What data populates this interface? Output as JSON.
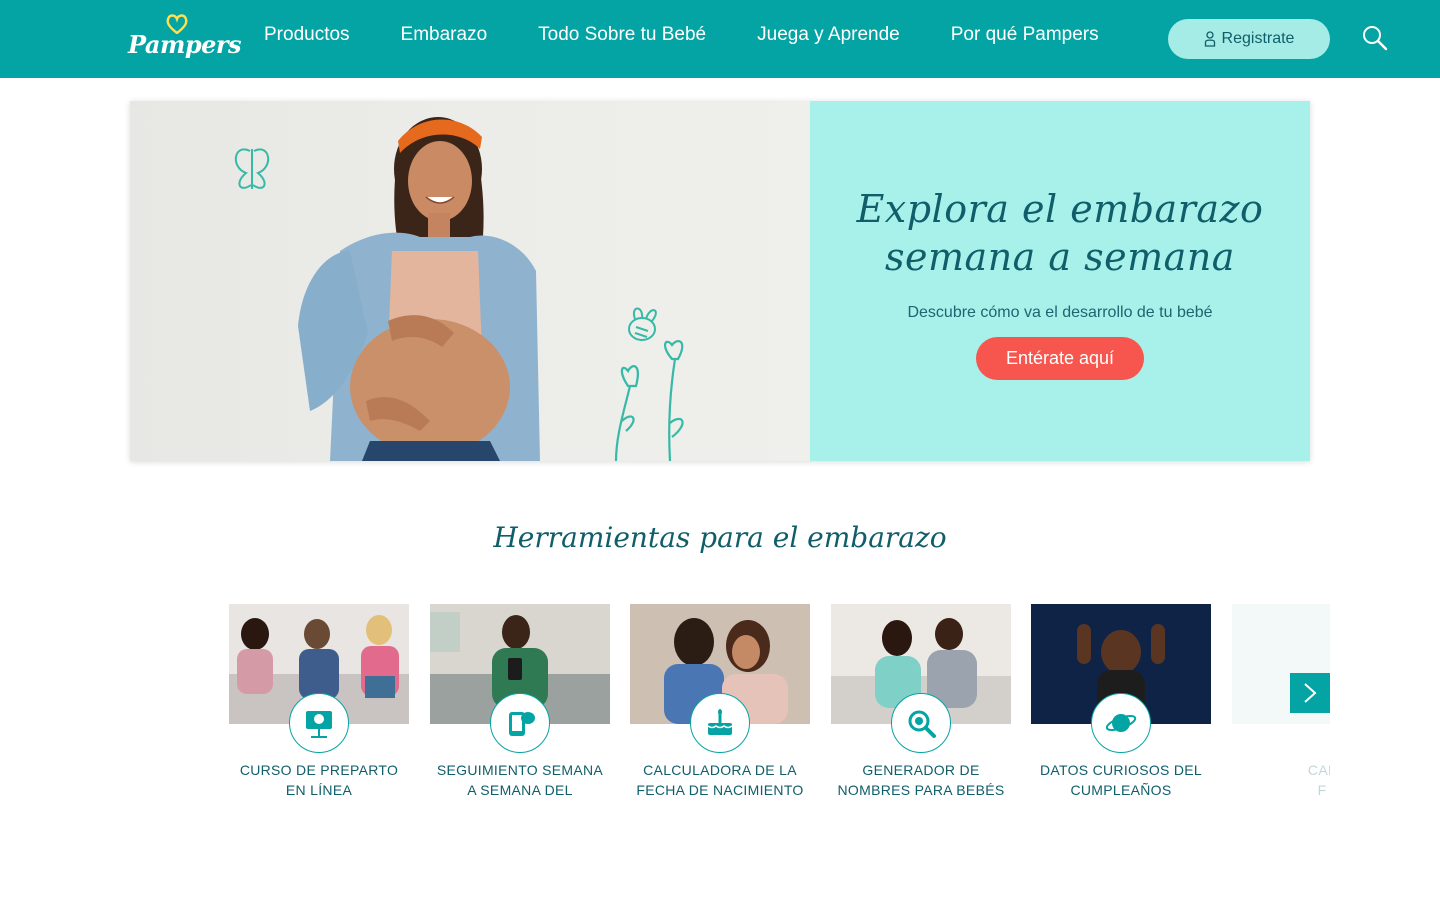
{
  "header": {
    "logo_text": "Pampers",
    "nav": [
      "Productos",
      "Embarazo",
      "Todo Sobre tu Bebé",
      "Juega y Aprende",
      "Por qué Pampers"
    ],
    "register_label": "Registrate"
  },
  "hero": {
    "title_line1": "Explora el embarazo",
    "title_line2": "semana a semana",
    "subtitle": "Descubre cómo va el desarrollo de tu bebé",
    "cta": "Entérate aquí"
  },
  "tools": {
    "title": "Herramientas para el embarazo",
    "cards": [
      {
        "line1": "CURSO DE PREPARTO",
        "line2": "EN LÍNEA",
        "icon": "presentation-baby-icon"
      },
      {
        "line1": "SEGUIMIENTO SEMANA",
        "line2": "A SEMANA DEL",
        "icon": "phone-chat-icon"
      },
      {
        "line1": "CALCULADORA DE LA",
        "line2": "FECHA DE NACIMIENTO",
        "icon": "birthday-cake-icon"
      },
      {
        "line1": "GENERADOR DE",
        "line2": "NOMBRES PARA BEBÉS",
        "icon": "magnifier-icon"
      },
      {
        "line1": "DATOS CURIOSOS DEL",
        "line2": "CUMPLEAÑOS",
        "icon": "planet-icon"
      },
      {
        "line1": "CAL",
        "line2": "F",
        "icon": "calendar-icon"
      }
    ]
  },
  "colors": {
    "teal": "#05a4a4",
    "mint": "#a8f0ea",
    "dark_teal": "#0f5e6a",
    "coral": "#f6564d"
  }
}
